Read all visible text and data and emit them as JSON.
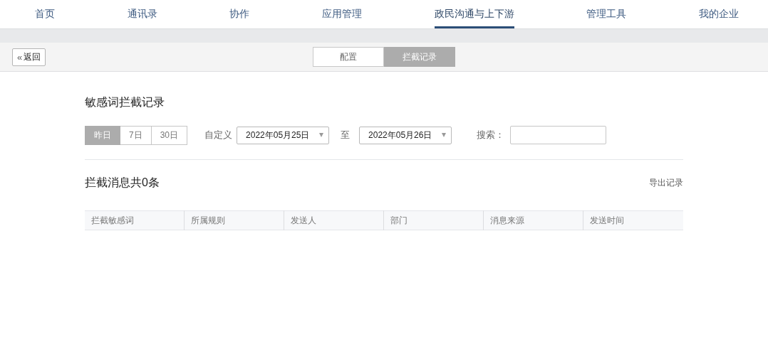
{
  "nav": {
    "items": [
      {
        "label": "首页",
        "selected": false
      },
      {
        "label": "通讯录",
        "selected": false
      },
      {
        "label": "协作",
        "selected": false
      },
      {
        "label": "应用管理",
        "selected": false
      },
      {
        "label": "政民沟通与上下游",
        "selected": true
      },
      {
        "label": "管理工具",
        "selected": false
      },
      {
        "label": "我的企业",
        "selected": false
      }
    ]
  },
  "toolbar": {
    "back_button": {
      "icon": "«",
      "label": "返回"
    },
    "tabs": [
      {
        "label": "配置",
        "selected": false
      },
      {
        "label": "拦截记录",
        "selected": true
      }
    ]
  },
  "title": "敏感词拦截记录",
  "filters": {
    "ranges": [
      {
        "label": "昨日",
        "selected": true
      },
      {
        "label": "7日",
        "selected": false
      },
      {
        "label": "30日",
        "selected": false
      }
    ],
    "custom_label": "自定义",
    "start_date": "2022年05月25日",
    "to_label": "至",
    "end_date": "2022年05月26日",
    "search_label": "搜索："
  },
  "summary": "拦截消息共0条",
  "export_link": "导出记录",
  "table": {
    "columns": [
      "拦截敏感词",
      "所属规则",
      "发送人",
      "部门",
      "消息来源",
      "发送时间"
    ]
  }
}
